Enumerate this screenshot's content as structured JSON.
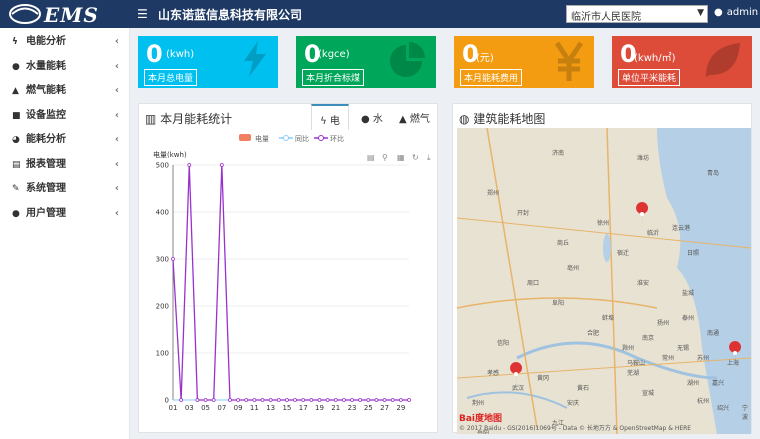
{
  "header": {
    "logo_text": "EMS",
    "company": "山东诺蓝信息科技有限公司",
    "hospital": "临沂市人民医院",
    "user": "admin"
  },
  "sidebar": {
    "items": [
      {
        "label": "电能分析",
        "icon": "bolt-icon"
      },
      {
        "label": "水量能耗",
        "icon": "drop-icon"
      },
      {
        "label": "燃气能耗",
        "icon": "flame-icon"
      },
      {
        "label": "设备监控",
        "icon": "monitor-icon"
      },
      {
        "label": "能耗分析",
        "icon": "pie-icon"
      },
      {
        "label": "报表管理",
        "icon": "file-icon"
      },
      {
        "label": "系统管理",
        "icon": "wrench-icon"
      },
      {
        "label": "用户管理",
        "icon": "user-icon"
      }
    ]
  },
  "cards": [
    {
      "value": "0",
      "unit": "(kwh)",
      "label": "本月总电量",
      "color": "#00c0ef",
      "icon": "bolt-icon"
    },
    {
      "value": "0",
      "unit": "(kgce)",
      "label": "本月折合标煤",
      "color": "#00a65a",
      "icon": "pie-icon"
    },
    {
      "value": "0",
      "unit": "(元)",
      "label": "本月能耗费用",
      "color": "#f39c12",
      "icon": "yen-icon"
    },
    {
      "value": "0",
      "unit": "(kwh/㎡)",
      "label": "单位平米能耗",
      "color": "#dd4b39",
      "icon": "leaf-icon"
    }
  ],
  "energy_panel": {
    "title": "本月能耗统计",
    "tabs": [
      "电",
      "水",
      "燃气"
    ],
    "active_tab": "电"
  },
  "map_panel": {
    "title": "建筑能耗地图",
    "copyright": "© 2017 Baidu - GS(2016)1069号 - Data © 长地万方 & OpenStreetMap & HERE",
    "logo": "Bai度地图"
  },
  "chart_data": {
    "type": "line",
    "ylabel": "电量(kwh)",
    "ylim": [
      0,
      500
    ],
    "yticks": [
      0,
      100,
      200,
      300,
      400,
      500
    ],
    "x": [
      "01",
      "02",
      "03",
      "04",
      "05",
      "06",
      "07",
      "08",
      "09",
      "10",
      "11",
      "12",
      "13",
      "14",
      "15",
      "16",
      "17",
      "18",
      "19",
      "20",
      "21",
      "22",
      "23",
      "24",
      "25",
      "26",
      "27",
      "28",
      "29",
      "30"
    ],
    "xticklabels": [
      "01",
      "03",
      "05",
      "07",
      "09",
      "11",
      "13",
      "15",
      "17",
      "19",
      "21",
      "23",
      "25",
      "27",
      "29"
    ],
    "legend": [
      "电量",
      "同比",
      "环比"
    ],
    "series": [
      {
        "name": "电量",
        "color": "#f08060",
        "values": [
          0,
          0,
          0,
          0,
          0,
          0,
          0,
          0,
          0,
          0,
          0,
          0,
          0,
          0,
          0,
          0,
          0,
          0,
          0,
          0,
          0,
          0,
          0,
          0,
          0,
          0,
          0,
          0,
          0,
          0
        ]
      },
      {
        "name": "同比",
        "color": "#87cefa",
        "values": [
          0,
          0,
          0,
          0,
          0,
          0,
          0,
          0,
          0,
          0,
          0,
          0,
          0,
          0,
          0,
          0,
          0,
          0,
          0,
          0,
          0,
          0,
          0,
          0,
          0,
          0,
          0,
          0,
          0,
          0
        ]
      },
      {
        "name": "环比",
        "color": "#9932cc",
        "values": [
          300,
          0,
          500,
          0,
          0,
          0,
          500,
          0,
          0,
          0,
          0,
          0,
          0,
          0,
          0,
          0,
          0,
          0,
          0,
          0,
          0,
          0,
          0,
          0,
          0,
          0,
          0,
          0,
          0,
          0
        ]
      }
    ]
  },
  "map_cities": [
    "济南",
    "潍坊",
    "青岛",
    "临沂",
    "日照",
    "徐州",
    "连云港",
    "宿迁",
    "淮安",
    "盐城",
    "蚌埠",
    "合肥",
    "南京",
    "扬州",
    "泰州",
    "南通",
    "苏州",
    "上海",
    "杭州",
    "武汉",
    "黄冈",
    "安庆",
    "九江",
    "芜湖",
    "无锡",
    "常州",
    "郑州",
    "开封",
    "商丘",
    "周口",
    "阜阳",
    "亳州",
    "信阳",
    "孝感",
    "荆州",
    "岳阳",
    "黄石",
    "滁州",
    "马鞍山",
    "宣城",
    "湖州",
    "嘉兴",
    "绍兴",
    "宁波"
  ]
}
